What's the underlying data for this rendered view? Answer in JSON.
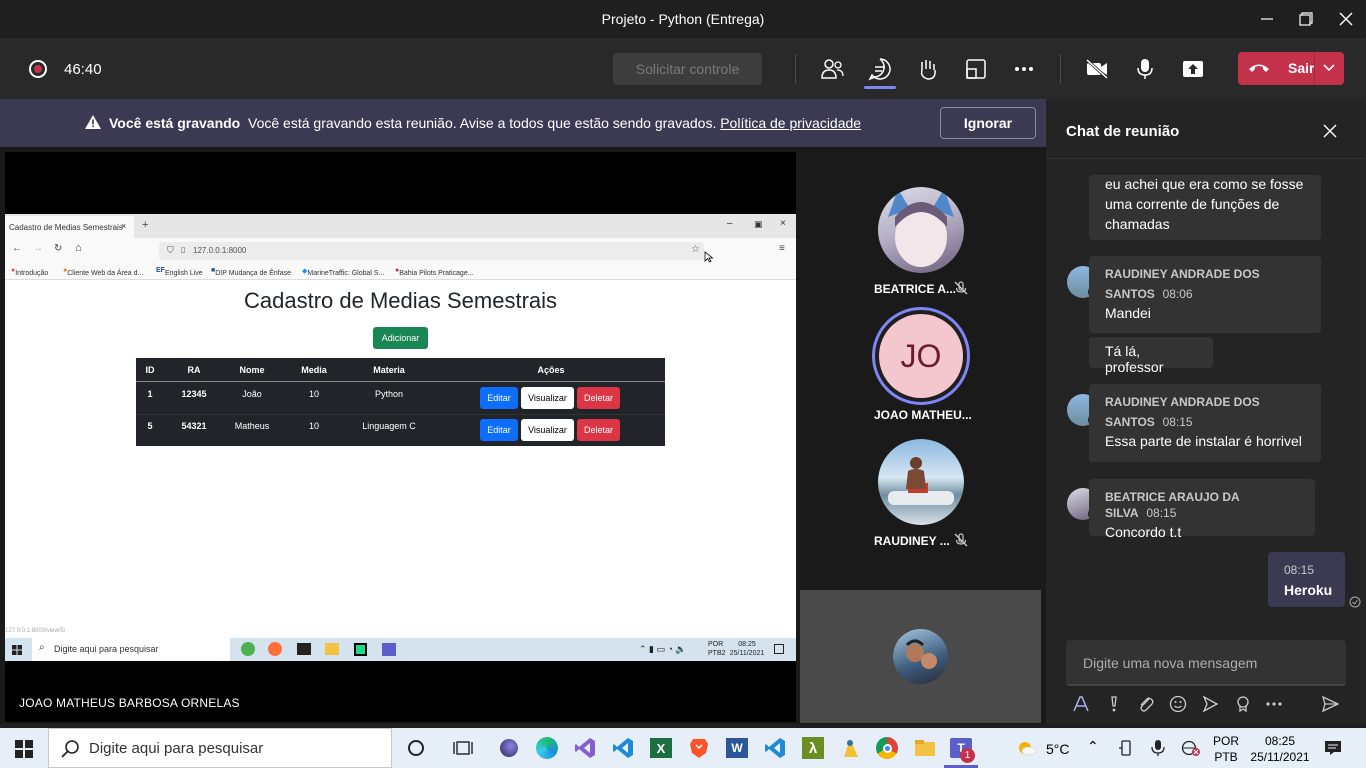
{
  "window": {
    "title": "Projeto - Python (Entrega)"
  },
  "toolbar": {
    "timer": "46:40",
    "request_control": "Solicitar controle",
    "leave_label": "Sair"
  },
  "banner": {
    "title": "Você está gravando",
    "message": "Você está gravando esta reunião. Avise a todos que estão sendo gravados.",
    "link": "Política de privacidade",
    "dismiss": "Ignorar"
  },
  "share": {
    "presenter_name": "JOAO MATHEUS BARBOSA ORNELAS",
    "browser": {
      "tab_title": "Cadastro de Medias Semestrais",
      "url": "127.0.0.1:8000",
      "bookmarks": [
        "Introdução",
        "Cliente Web da Área d...",
        "English Live",
        "DIP Mudança de Ênfase",
        "MarineTraffic: Global S...",
        "Bahia Pilots Praticage..."
      ],
      "status_url": "127.0.0.1:8000/view/5/"
    },
    "page": {
      "heading": "Cadastro de Medias Semestrais",
      "add_button": "Adicionar",
      "table": {
        "headers": [
          "ID",
          "RA",
          "Nome",
          "Media",
          "Materia",
          "Ações"
        ],
        "rows": [
          {
            "id": "1",
            "ra": "12345",
            "nome": "João",
            "media": "10",
            "materia": "Python"
          },
          {
            "id": "5",
            "ra": "54321",
            "nome": "Matheus",
            "media": "10",
            "materia": "Linguagem C"
          }
        ],
        "actions": {
          "edit": "Editar",
          "view": "Visualizar",
          "delete": "Deletar"
        }
      }
    },
    "inner_taskbar": {
      "search": "Digite aqui para pesquisar",
      "lang1": "POR",
      "lang2": "PTB2",
      "time": "08:25",
      "date": "25/11/2021"
    }
  },
  "participants": [
    {
      "name": "BEATRICE A...",
      "muted": true
    },
    {
      "name": "JOAO MATHEU...",
      "initials": "JO",
      "muted": false
    },
    {
      "name": "RAUDINEY ...",
      "muted": true
    }
  ],
  "chat": {
    "title": "Chat de reunião",
    "messages": [
      {
        "text": "eu achei que era como se fosse uma corrente de funções de chamadas"
      },
      {
        "sender_line1": "RAUDINEY ANDRADE DOS",
        "sender_line2": "SANTOS",
        "time": "08:06",
        "text": "Mandei"
      },
      {
        "text": "Tá lá, professor"
      },
      {
        "sender_line1": "RAUDINEY ANDRADE DOS",
        "sender_line2": "SANTOS",
        "time": "08:15",
        "text": "Essa parte de instalar é horrivel"
      },
      {
        "sender": "BEATRICE ARAUJO DA SILVA",
        "time": "08:15",
        "text": "Concordo t.t"
      }
    ],
    "my_message": {
      "time": "08:15",
      "text": "Heroku"
    },
    "compose_placeholder": "Digite uma nova mensagem"
  },
  "taskbar": {
    "search": "Digite aqui para pesquisar",
    "weather": "5°C",
    "lang1": "POR",
    "lang2": "PTB",
    "time": "08:25",
    "date": "25/11/2021",
    "teams_badge": "1"
  },
  "colors": {
    "accent": "#6264a7",
    "leave": "#c4314b",
    "banner": "#3b3a52",
    "add_button": "#198754"
  }
}
